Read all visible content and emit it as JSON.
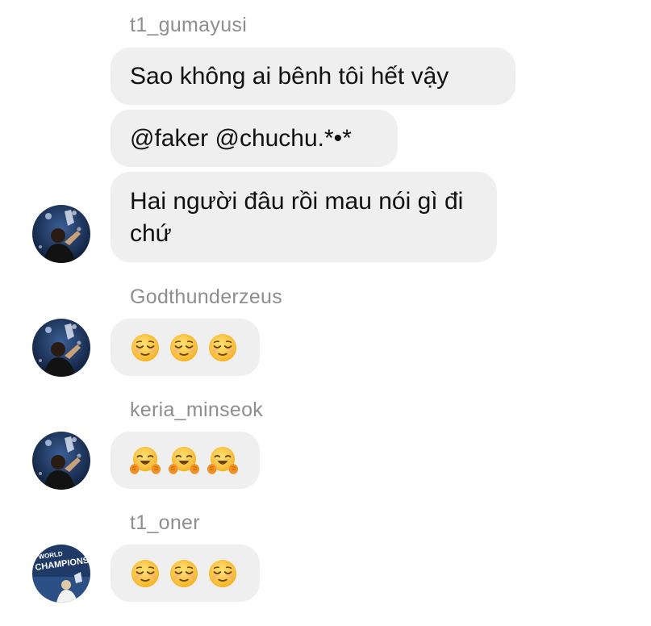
{
  "groups": [
    {
      "sender": "t1_gumayusi",
      "messages": [
        "Sao không ai bênh tôi hết vậy",
        "@faker @chuchu.*•*",
        "Hai người đâu rồi mau nói gì đi chứ"
      ],
      "avatar": "player-avatar"
    },
    {
      "sender": "Godthunderzeus",
      "emoji": [
        "relieved-face",
        "relieved-face",
        "relieved-face"
      ],
      "avatar": "player-avatar"
    },
    {
      "sender": "keria_minseok",
      "emoji": [
        "hugging-face",
        "hugging-face",
        "hugging-face"
      ],
      "avatar": "player-avatar"
    },
    {
      "sender": "t1_oner",
      "emoji": [
        "relieved-face",
        "relieved-face",
        "relieved-face"
      ],
      "avatar": "champions-avatar",
      "avatar_text": [
        "WORLD",
        "CHAMPIONS"
      ]
    }
  ],
  "colors": {
    "bubble": "#efefef",
    "sender_text": "#8e8e8e",
    "message_text": "#111111",
    "emoji_face": "#ffcc4d",
    "emoji_feature": "#664500",
    "emoji_hand": "#f19020",
    "avatar_bg": "#1f3a66"
  }
}
